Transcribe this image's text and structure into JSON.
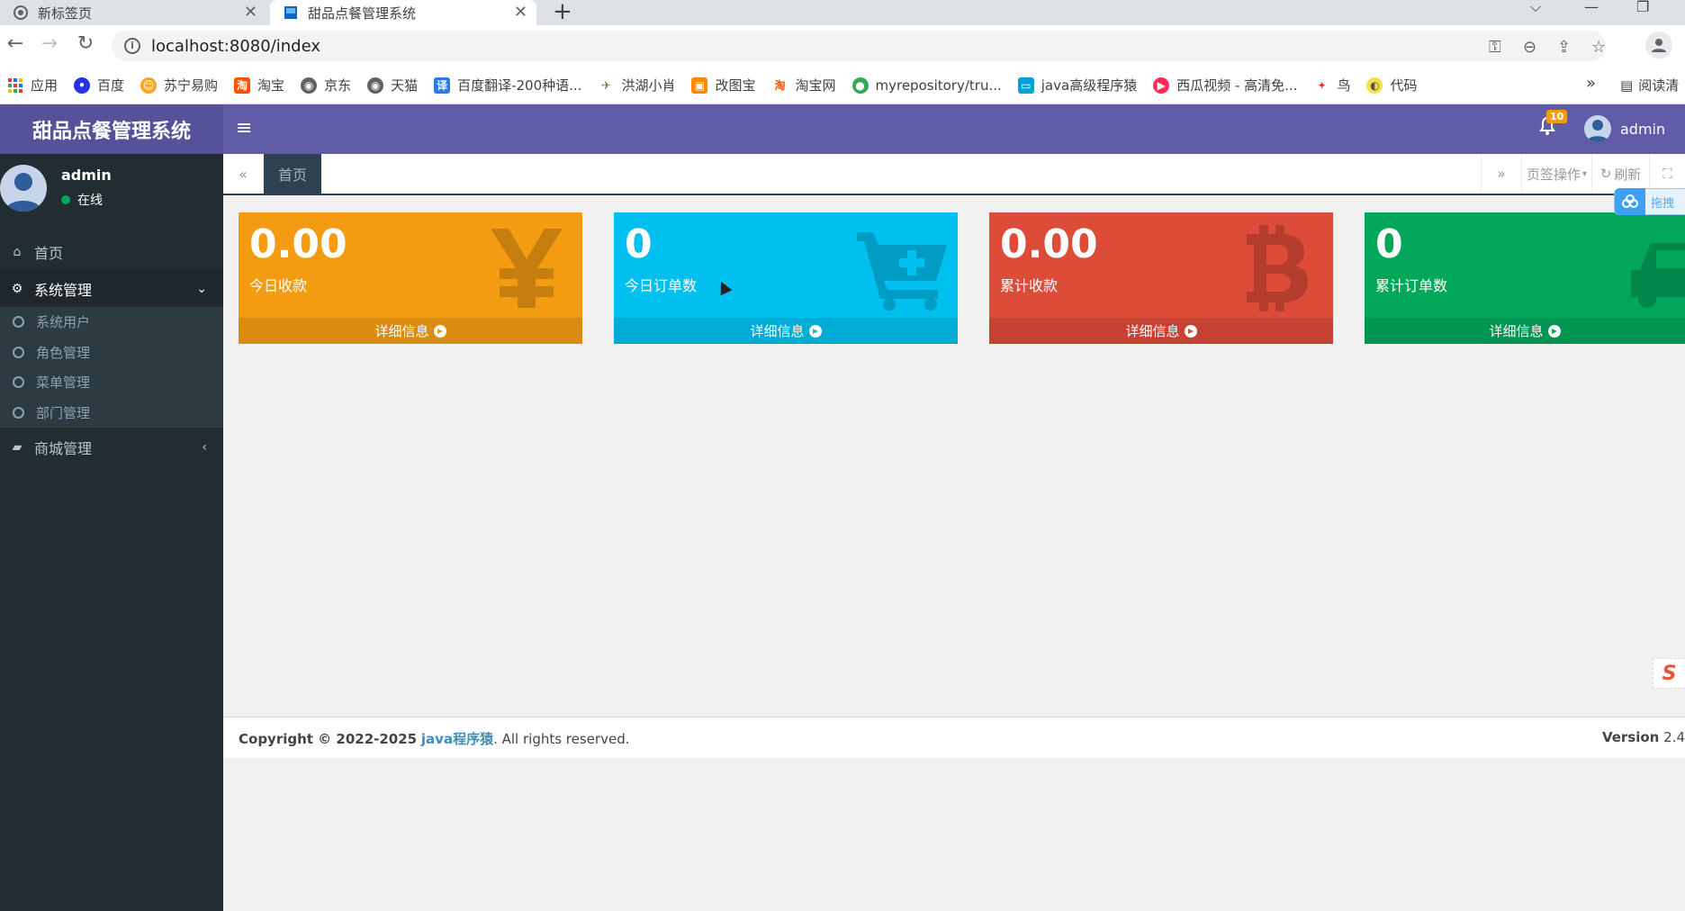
{
  "browser": {
    "tabs": [
      {
        "title": "新标签页",
        "active": false
      },
      {
        "title": "甜品点餐管理系统",
        "active": true
      }
    ],
    "new_tab": "+",
    "url": "localhost:8080/index",
    "bookmarks": [
      {
        "label": "应用",
        "icon": "apps-grid-icon",
        "color": "#1a73e8"
      },
      {
        "label": "百度",
        "icon": "baidu-paw-icon",
        "color": "#2932e1"
      },
      {
        "label": "苏宁易购",
        "icon": "suning-icon",
        "color": "#f5a623"
      },
      {
        "label": "淘宝",
        "icon": "taobao-icon",
        "color": "#ff5000"
      },
      {
        "label": "京东",
        "icon": "globe-icon",
        "color": "#5f6368"
      },
      {
        "label": "天猫",
        "icon": "globe-icon",
        "color": "#5f6368"
      },
      {
        "label": "百度翻译-200种语...",
        "icon": "translate-icon",
        "color": "#2a7ae2"
      },
      {
        "label": "洪湖小肖",
        "icon": "bird-icon",
        "color": "#7c6a46"
      },
      {
        "label": "改图宝",
        "icon": "gaitubao-icon",
        "color": "#ff8a00"
      },
      {
        "label": "淘宝网",
        "icon": "taobao-icon",
        "color": "#ff5000"
      },
      {
        "label": "myrepository/tru...",
        "icon": "chrome-icon",
        "color": "#34a853"
      },
      {
        "label": "java高级程序猿",
        "icon": "bilibili-icon",
        "color": "#00a1d6"
      },
      {
        "label": "西瓜视频 - 高清免...",
        "icon": "xigua-icon",
        "color": "#fe2c55"
      },
      {
        "label": "鸟",
        "icon": "bird-red-icon",
        "color": "#e53935"
      },
      {
        "label": "代码",
        "icon": "code-icon",
        "color": "#f4e04d"
      }
    ],
    "more": "»",
    "reading_list": "阅读清"
  },
  "app": {
    "title": "甜品点餐管理系统",
    "notifications_count": "10",
    "username": "admin",
    "accent": "#605ca8"
  },
  "sidebar": {
    "user": {
      "name": "admin",
      "status": "在线"
    },
    "items": [
      {
        "label": "首页",
        "icon": "home-icon"
      },
      {
        "label": "系统管理",
        "icon": "cogs-icon",
        "expanded": true
      },
      {
        "label": "商城管理",
        "icon": "shopping-bag-icon",
        "expanded": false
      }
    ],
    "submenu": [
      "系统用户",
      "角色管理",
      "菜单管理",
      "部门管理"
    ]
  },
  "tabbar": {
    "home_tab": "首页",
    "tab_ops": "页签操作",
    "refresh": "刷新"
  },
  "float": {
    "drag_label": "拖拽"
  },
  "stats": [
    {
      "value": "0.00",
      "label": "今日收款",
      "color": "#f39c12",
      "icon": "yen-icon",
      "footer": "详细信息"
    },
    {
      "value": "0",
      "label": "今日订单数",
      "color": "#00c0ef",
      "icon": "cart-plus-icon",
      "footer": "详细信息"
    },
    {
      "value": "0.00",
      "label": "累计收款",
      "color": "#dd4b39",
      "icon": "bitcoin-icon",
      "footer": "详细信息"
    },
    {
      "value": "0",
      "label": "累计订单数",
      "color": "#00a65a",
      "icon": "car-icon",
      "footer": "详细信息"
    }
  ],
  "footer": {
    "copyright_prefix": "Copyright © 2022-2025",
    "company": "java程序猿",
    "suffix": ". All rights reserved.",
    "version_label": "Version",
    "version": "2.4"
  }
}
